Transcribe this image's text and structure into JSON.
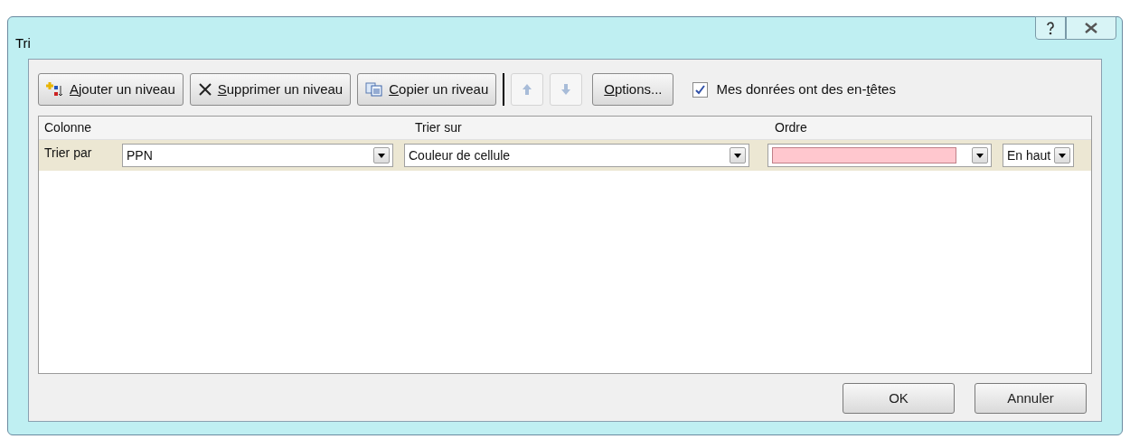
{
  "window": {
    "title": "Tri"
  },
  "toolbar": [
    {
      "kind": "add",
      "key": "A",
      "post": "jouter un niveau",
      "disabled": false
    },
    {
      "kind": "delete",
      "key": "S",
      "post": "upprimer un niveau",
      "disabled": false
    },
    {
      "kind": "copy",
      "key": "C",
      "post": "opier un riveau",
      "disabled": false
    },
    {
      "kind": "up",
      "disabled": true
    },
    {
      "kind": "down",
      "disabled": true
    },
    {
      "kind": "options",
      "key": "O",
      "post": "ptions...",
      "disabled": false
    }
  ],
  "headers_checkbox": {
    "pre": "Mes donrées ont des en-",
    "key": "t",
    "post": "êtes",
    "checked": true
  },
  "columns": [
    "Colonne",
    "Trier sur",
    "Ordre"
  ],
  "rows": [
    {
      "label": "Trier par",
      "column": "PPN",
      "sort_on": "Couleur de cellule",
      "color": "#ffc7ce",
      "position": "En haut",
      "selected": true
    }
  ],
  "buttons": [
    "OK",
    "Annuler"
  ]
}
